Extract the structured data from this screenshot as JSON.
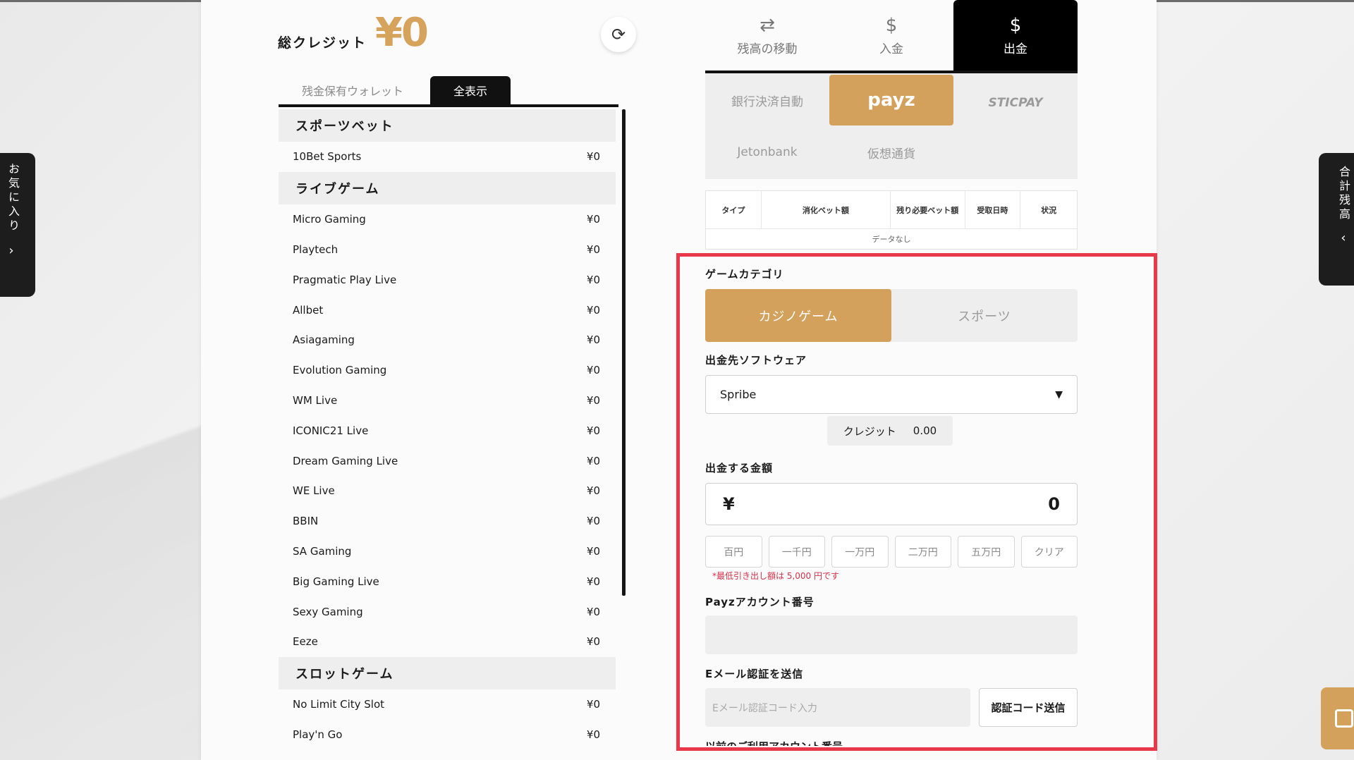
{
  "side_left": {
    "text": "お気に入り",
    "chevron": "›"
  },
  "side_right": {
    "text": "合計残高",
    "chevron": "‹"
  },
  "header": {
    "credit_label": "総クレジット",
    "credit_value": "¥0",
    "refresh_icon": "⟳"
  },
  "wallet_tabs": [
    "残金保有ウォレット",
    "全表示"
  ],
  "sections": [
    {
      "title": "スポーツベット",
      "rows": [
        {
          "name": "10Bet Sports",
          "amount": "¥0"
        }
      ]
    },
    {
      "title": "ライブゲーム",
      "rows": [
        {
          "name": "Micro Gaming",
          "amount": "¥0"
        },
        {
          "name": "Playtech",
          "amount": "¥0"
        },
        {
          "name": "Pragmatic Play Live",
          "amount": "¥0"
        },
        {
          "name": "Allbet",
          "amount": "¥0"
        },
        {
          "name": "Asiagaming",
          "amount": "¥0"
        },
        {
          "name": "Evolution Gaming",
          "amount": "¥0"
        },
        {
          "name": "WM Live",
          "amount": "¥0"
        },
        {
          "name": "ICONIC21 Live",
          "amount": "¥0"
        },
        {
          "name": "Dream Gaming Live",
          "amount": "¥0"
        },
        {
          "name": "WE Live",
          "amount": "¥0"
        },
        {
          "name": "BBIN",
          "amount": "¥0"
        },
        {
          "name": "SA Gaming",
          "amount": "¥0"
        },
        {
          "name": "Big Gaming Live",
          "amount": "¥0"
        },
        {
          "name": "Sexy Gaming",
          "amount": "¥0"
        },
        {
          "name": "Eeze",
          "amount": "¥0"
        }
      ]
    },
    {
      "title": "スロットゲーム",
      "rows": [
        {
          "name": "No Limit City Slot",
          "amount": "¥0"
        },
        {
          "name": "Play'n Go",
          "amount": "¥0"
        }
      ]
    }
  ],
  "main_tabs": [
    {
      "label": "残高の移動",
      "icon": "⇄"
    },
    {
      "label": "入金",
      "icon": "$"
    },
    {
      "label": "出金",
      "icon": "$"
    }
  ],
  "methods": {
    "bank": "銀行決済自動",
    "payz": "payz",
    "sticpay": "STICPAY",
    "jeton": "Jetonbank",
    "crypto": "仮想通貨"
  },
  "history": {
    "headers": [
      "タイプ",
      "消化ベット額",
      "残り必要ベット額",
      "受取日時",
      "状況"
    ],
    "empty": "データなし"
  },
  "form": {
    "category_label": "ゲームカテゴリ",
    "category_on": "カジノゲーム",
    "category_off": "スポーツ",
    "software_label": "出金先ソフトウェア",
    "software_value": "Spribe",
    "select_arrow": "▼",
    "credit_label": "クレジット",
    "credit_value": "0.00",
    "amount_label": "出金する金額",
    "currency": "¥",
    "amount_value": "0",
    "quick": [
      "百円",
      "一千円",
      "一万円",
      "二万円",
      "五万円",
      "クリア"
    ],
    "note": "*最低引き出し額は 5,000 円です",
    "account_label": "Payzアカウント番号",
    "email_label": "Eメール認証を送信",
    "email_placeholder": "Eメール認証コード入力",
    "send_button": "認証コード送信",
    "next_label": "以前のご利用アカウント番号"
  }
}
